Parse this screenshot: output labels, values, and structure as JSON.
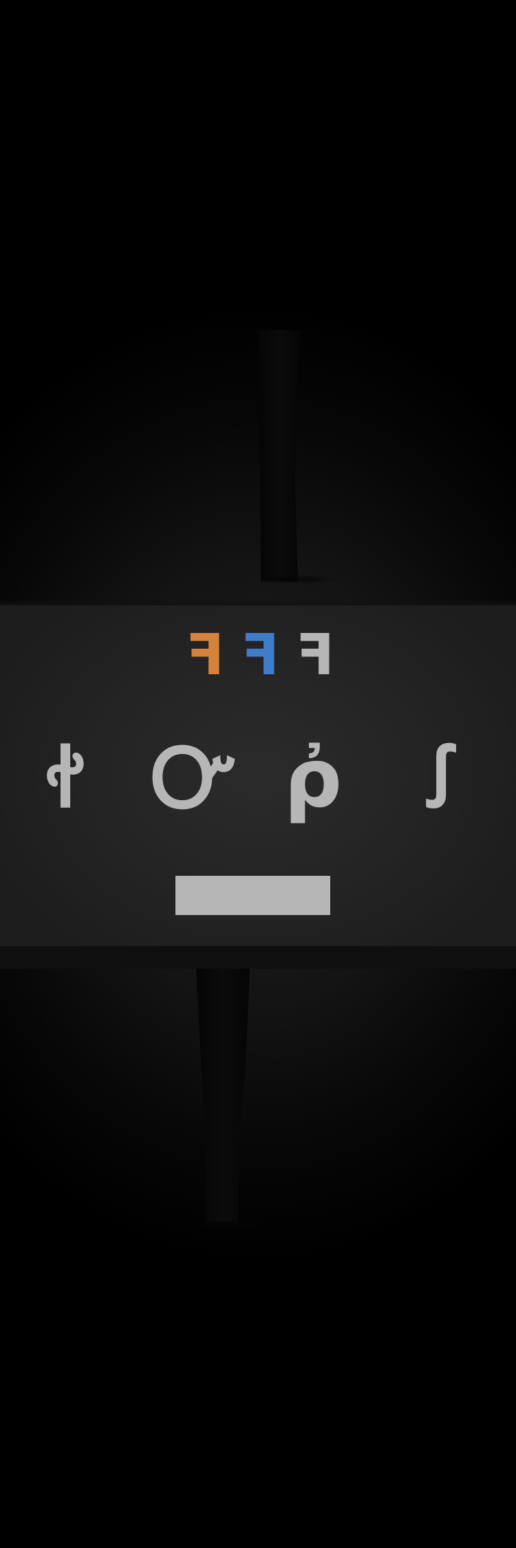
{
  "scene": {
    "markers": [
      {
        "glyph": "ꟻ",
        "color": "#d4833d"
      },
      {
        "glyph": "ꟻ",
        "color": "#3f7ccc"
      },
      {
        "glyph": "ꟻ",
        "color": "#b6b6b6"
      }
    ],
    "glyphs": [
      {
        "glyph": "ꬷ"
      },
      {
        "glyph": "Ꮕ"
      },
      {
        "glyph": "ῤ"
      },
      {
        "glyph": "ꭍ"
      }
    ],
    "bar": {
      "color": "#b6b6b6"
    }
  },
  "palette": {
    "background": "#000000",
    "panel": "#242424",
    "glyph": "#b6b6b6"
  }
}
